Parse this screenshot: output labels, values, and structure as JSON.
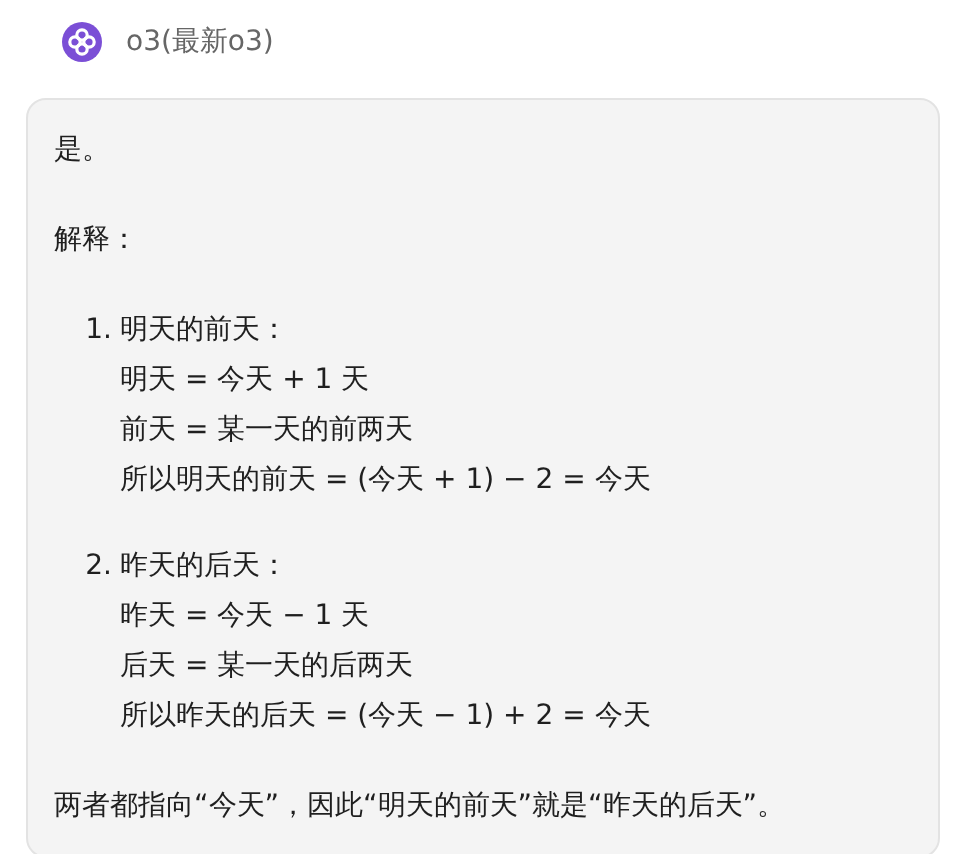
{
  "header": {
    "title": "o3(最新o3)"
  },
  "message": {
    "blocks": [
      {
        "kind": "paragraph",
        "text": "是。"
      },
      {
        "kind": "paragraph",
        "text": "解释："
      },
      {
        "kind": "list",
        "items": [
          {
            "number": "1.",
            "title": "明天的前天：",
            "lines": [
              "明天 = 今天 + 1 天",
              "前天 = 某一天的前两天",
              "所以明天的前天 = (今天 + 1) − 2 = 今天"
            ]
          },
          {
            "number": "2.",
            "title": "昨天的后天：",
            "lines": [
              "昨天 = 今天 − 1 天",
              "后天 = 某一天的后两天",
              "所以昨天的后天 = (今天 − 1) + 2 = 今天"
            ]
          }
        ]
      },
      {
        "kind": "paragraph",
        "text": "两者都指向“今天”，因此“明天的前天”就是“昨天的后天”。"
      }
    ]
  }
}
